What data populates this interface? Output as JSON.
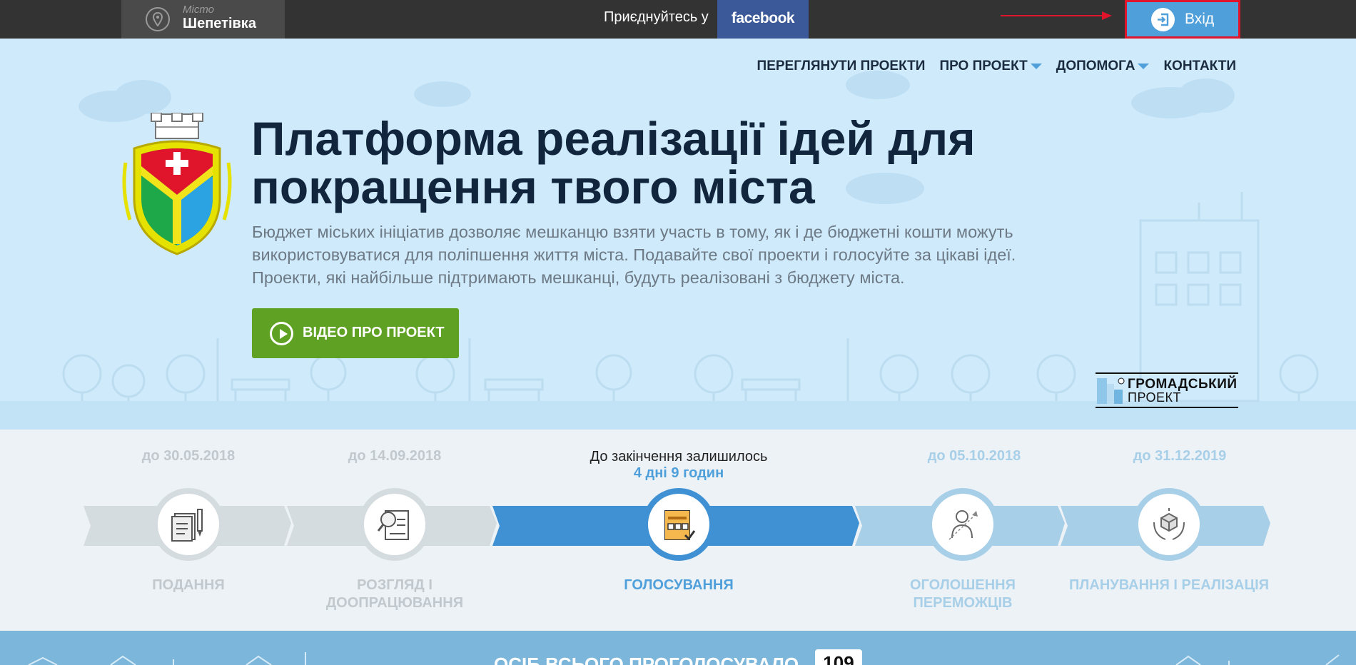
{
  "topbar": {
    "city_caption": "Місто",
    "city_name": "Шепетівка",
    "join_text": "Приєднуйтесь у",
    "facebook_label": "facebook",
    "login_label": "Вхід"
  },
  "nav": {
    "items": [
      {
        "label": "ПЕРЕГЛЯНУТИ ПРОЕКТИ",
        "dropdown": false
      },
      {
        "label": "ПРО ПРОЕКТ",
        "dropdown": true
      },
      {
        "label": "ДОПОМОГА",
        "dropdown": true
      },
      {
        "label": "КОНТАКТИ",
        "dropdown": false
      }
    ]
  },
  "hero": {
    "title_line1": "Платформа реалізації ідей для",
    "title_line2": "покращення твого міста",
    "desc_line1": "Бюджет міських ініціатив дозволяє мешканцю взяти участь в тому, як і де бюджетні кошти можуть",
    "desc_line2": "використовуватися для поліпшення життя міста. Подавайте свої проекти і голосуйте за цікаві ідеї.",
    "desc_line3": "Проекти, які найбільше підтримають мешканці, будуть реалізовані з бюджету міста.",
    "video_button": "ВІДЕО ПРО ПРОЕКТ",
    "partner_line1": "ГРОМАДСЬКИЙ",
    "partner_line2": "ПРОЕКТ"
  },
  "stages": {
    "remaining_text": "До закінчення залишилось",
    "remaining_value": "4 дні 9 годин",
    "items": [
      {
        "date": "до 30.05.2018",
        "label_line1": "ПОДАННЯ",
        "label_line2": "",
        "status": "past",
        "icon": "document-icon"
      },
      {
        "date": "до 14.09.2018",
        "label_line1": "РОЗГЛЯД І",
        "label_line2": "ДООПРАЦЮВАННЯ",
        "status": "past",
        "icon": "magnifier-document-icon"
      },
      {
        "date": "",
        "label_line1": "ГОЛОСУВАННЯ",
        "label_line2": "",
        "status": "active",
        "icon": "ballot-icon"
      },
      {
        "date": "до 05.10.2018",
        "label_line1": "ОГОЛОШЕННЯ",
        "label_line2": "ПЕРЕМОЖЦІВ",
        "status": "future",
        "icon": "winner-icon"
      },
      {
        "date": "до 31.12.2019",
        "label_line1": "ПЛАНУВАННЯ І РЕАЛІЗАЦІЯ",
        "label_line2": "",
        "status": "future",
        "icon": "hands-cube-icon"
      }
    ]
  },
  "counter": {
    "label": "ОСІБ ВСЬОГО ПРОГОЛОСУВАЛО",
    "value": "109"
  },
  "colors": {
    "topbar": "#333333",
    "facebook": "#3b5998",
    "login": "#4f9fda",
    "highlight": "#e0142b",
    "video_button": "#5fa122",
    "active_stage": "#3f91d3"
  }
}
